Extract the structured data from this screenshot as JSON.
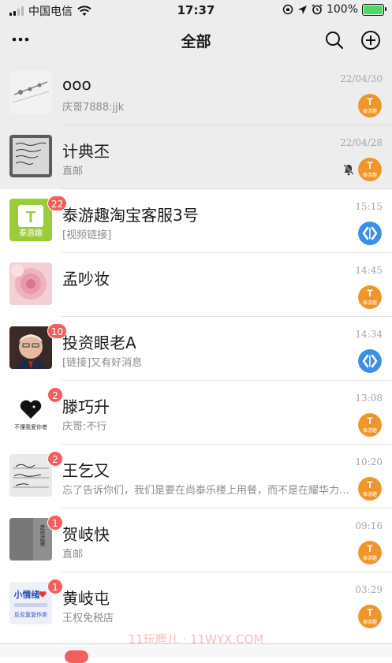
{
  "status_bar": {
    "carrier": "中国电信",
    "time": "17:37",
    "battery_pct": "100%"
  },
  "header": {
    "title": "全部",
    "more_icon": "ellipsis-icon",
    "search_icon": "search-icon",
    "add_icon": "add-circle-icon"
  },
  "chats": [
    {
      "name": "ooo",
      "preview": "庆哥7888:jjk",
      "time": "22/04/30",
      "badge": "",
      "pinned": true,
      "muted": false,
      "channel": "tyq"
    },
    {
      "name": "计典丕",
      "preview": "直邮",
      "time": "22/04/28",
      "badge": "",
      "pinned": true,
      "muted": true,
      "channel": "tyq"
    },
    {
      "name": "泰游趣淘宝客服3号",
      "preview": "[视频链接]",
      "time": "15:15",
      "badge": "22",
      "pinned": false,
      "muted": false,
      "channel": "blue"
    },
    {
      "name": "孟吵妆",
      "preview": "",
      "time": "14:45",
      "badge": "",
      "pinned": false,
      "muted": false,
      "channel": "tyq"
    },
    {
      "name": "投资眼老A",
      "preview": "[链接]又有好消息",
      "time": "14:34",
      "badge": "10",
      "pinned": false,
      "muted": false,
      "channel": "blue"
    },
    {
      "name": "滕巧升",
      "preview": "庆哥:不行",
      "time": "13:08",
      "badge": "2",
      "pinned": false,
      "muted": false,
      "channel": "tyq"
    },
    {
      "name": "王乞又",
      "preview": "忘了告诉你们，我们是要在尚泰乐楼上用餐，而不是在耀华力…",
      "time": "10:20",
      "badge": "2",
      "pinned": false,
      "muted": false,
      "channel": "tyq"
    },
    {
      "name": "贺岐快",
      "preview": "直邮",
      "time": "09:16",
      "badge": "1",
      "pinned": false,
      "muted": false,
      "channel": "tyq"
    },
    {
      "name": "黄岐屯",
      "preview": "王权免税店",
      "time": "03:29",
      "badge": "1",
      "pinned": false,
      "muted": false,
      "channel": "tyq"
    }
  ],
  "avatars": {
    "tyq_logo_text": "泰游趣",
    "heart_caption": "不懂我爱你者",
    "handwriting_note": "走在这里",
    "xiaoqingxu_title": "小情绪",
    "xiaoqingxu_sub": "反反复复作崇"
  },
  "watermark": "11玩鹿儿 · 11WYX.COM",
  "colors": {
    "badge": "#f25f5c",
    "channel_orange": "#f0952a",
    "channel_blue": "#3d8ee6",
    "pinned_bg": "#ededed"
  }
}
